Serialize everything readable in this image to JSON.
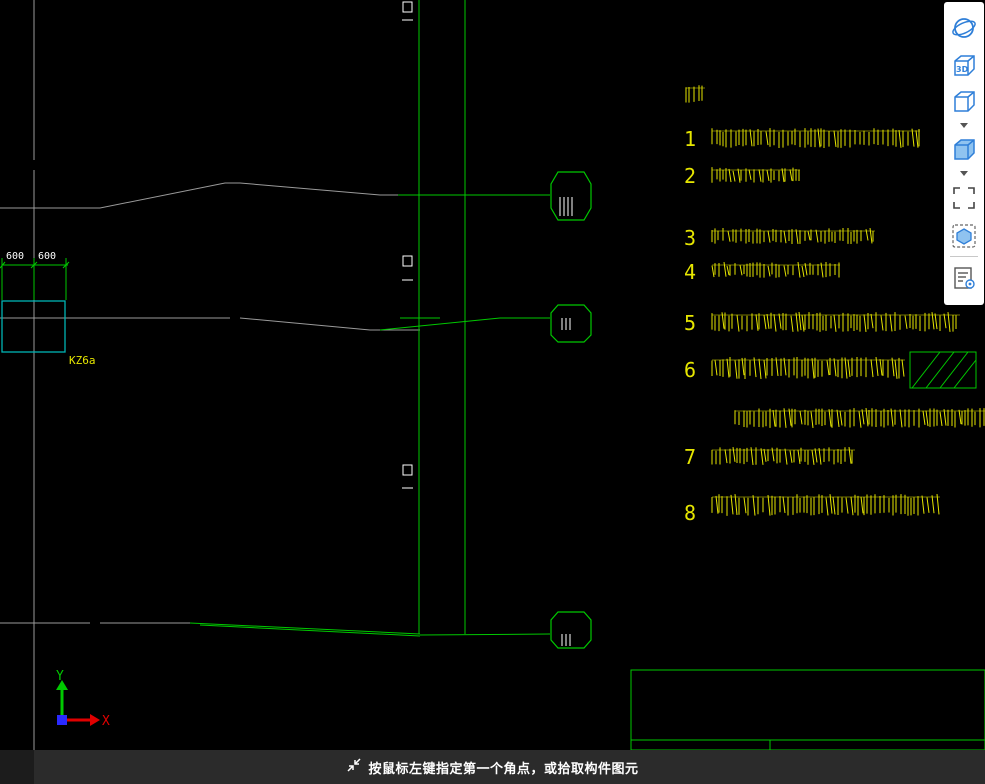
{
  "colors": {
    "background": "#000000",
    "grid_line": "#9a9a9a",
    "green": "#00c800",
    "yellow": "#e6e600",
    "cyan": "#00b4b4",
    "toolbar_bg": "#ffffff",
    "toolbar_icon_blue": "#2f7fd8",
    "statusbar_bg": "#2b2b2b"
  },
  "drawing": {
    "dims": [
      "600",
      "600"
    ],
    "column_label": "KZ6a",
    "axis": {
      "x": "X",
      "y": "Y"
    },
    "notes_numbers": [
      "1",
      "2",
      "3",
      "4",
      "5",
      "6",
      "7",
      "8"
    ]
  },
  "toolbar": {
    "items": [
      {
        "name": "orbit-icon"
      },
      {
        "name": "view-3d-icon",
        "label": "3D"
      },
      {
        "name": "view-cube-icon"
      },
      {
        "name": "view-cube-shaded-icon"
      },
      {
        "name": "zoom-extents-icon"
      },
      {
        "name": "select-component-icon"
      },
      {
        "name": "properties-view-icon"
      }
    ]
  },
  "status": {
    "message": "按鼠标左键指定第一个角点，或拾取构件图元"
  }
}
